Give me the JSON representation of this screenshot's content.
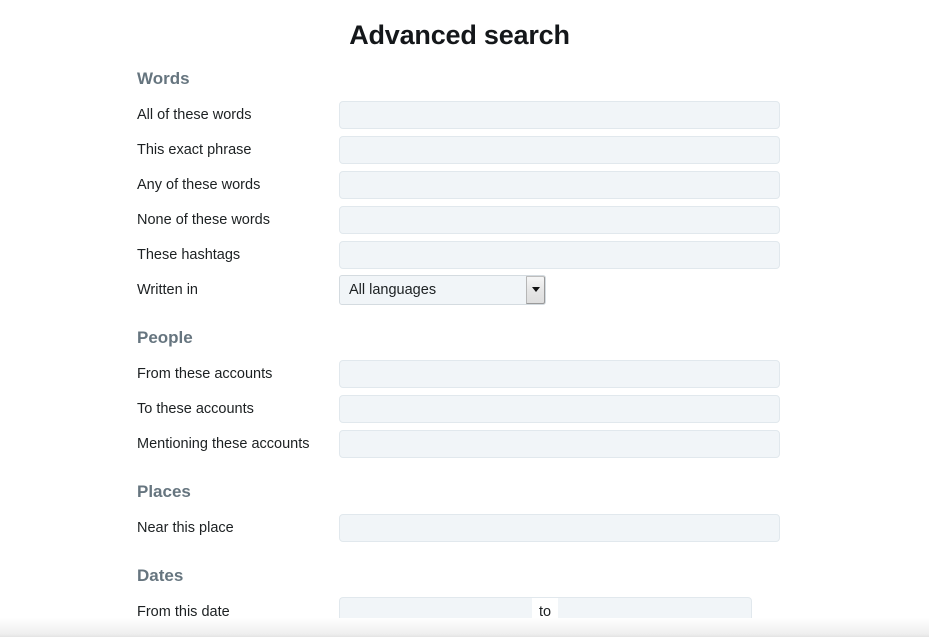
{
  "page": {
    "title": "Advanced search"
  },
  "sections": [
    {
      "id": "words",
      "heading": "Words",
      "fields": [
        {
          "label": "All of these words",
          "type": "text",
          "value": "",
          "placeholder": ""
        },
        {
          "label": "This exact phrase",
          "type": "text",
          "value": "",
          "placeholder": ""
        },
        {
          "label": "Any of these words",
          "type": "text",
          "value": "",
          "placeholder": ""
        },
        {
          "label": "None of these words",
          "type": "text",
          "value": "",
          "placeholder": ""
        },
        {
          "label": "These hashtags",
          "type": "text",
          "value": "",
          "placeholder": ""
        },
        {
          "label": "Written in",
          "type": "select",
          "value": "All languages",
          "options": [
            "All languages"
          ]
        }
      ]
    },
    {
      "id": "people",
      "heading": "People",
      "fields": [
        {
          "label": "From these accounts",
          "type": "text",
          "value": "",
          "placeholder": ""
        },
        {
          "label": "To these accounts",
          "type": "text",
          "value": "",
          "placeholder": ""
        },
        {
          "label": "Mentioning these accounts",
          "type": "text",
          "value": "",
          "placeholder": ""
        }
      ]
    },
    {
      "id": "places",
      "heading": "Places",
      "fields": [
        {
          "label": "Near this place",
          "type": "text",
          "value": "",
          "placeholder": ""
        }
      ]
    },
    {
      "id": "dates",
      "heading": "Dates",
      "fields": [
        {
          "label": "From this date",
          "type": "date-range",
          "from_value": "",
          "from_placeholder": "",
          "separator": "to",
          "to_value": "",
          "to_placeholder": ""
        }
      ]
    }
  ],
  "icons": {
    "select_caret": "chevron-down-icon"
  },
  "colors": {
    "heading": "#66757f",
    "label": "#1c2022",
    "input_background": "#f1f5f8",
    "input_border": "#e1e8ed",
    "title": "#14171a",
    "page_background": "#ffffff"
  }
}
